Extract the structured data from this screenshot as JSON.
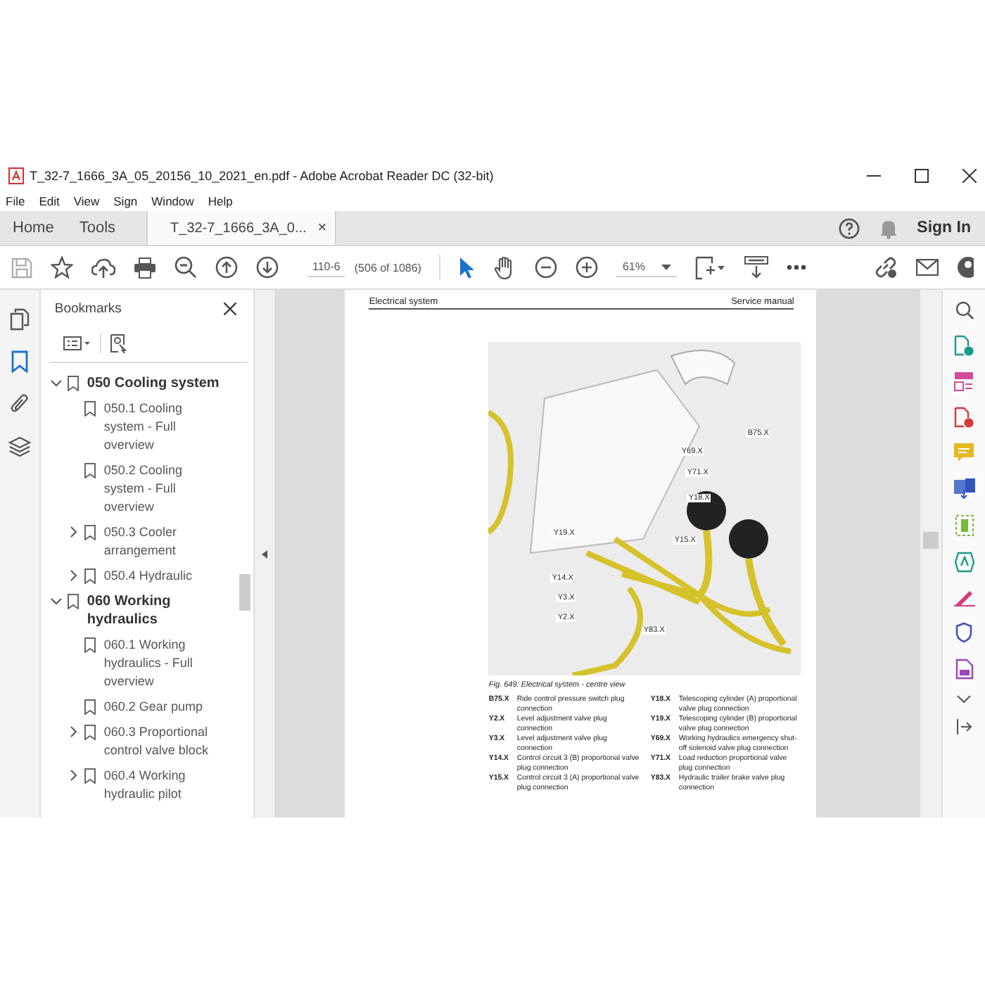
{
  "window": {
    "title": "T_32-7_1666_3A_05_20156_10_2021_en.pdf - Adobe Acrobat Reader DC (32-bit)"
  },
  "menu": [
    "File",
    "Edit",
    "View",
    "Sign",
    "Window",
    "Help"
  ],
  "tabs": [
    {
      "label": "Home",
      "selected": false
    },
    {
      "label": "Tools",
      "selected": false
    },
    {
      "label": "T_32-7_1666_3A_0...",
      "selected": true,
      "close": "×"
    }
  ],
  "sign_in": "Sign In",
  "toolbar": {
    "page": "110-6",
    "page_count": "(506 of 1086)",
    "zoom": "61%"
  },
  "rail": [
    {
      "kind": "pages",
      "selected": false
    },
    {
      "kind": "bookmarks",
      "selected": true
    },
    {
      "kind": "attachments",
      "selected": false
    },
    {
      "kind": "layers",
      "selected": false
    }
  ],
  "bookmarks": {
    "title": "Bookmarks",
    "items": [
      {
        "label": "050 Cooling system",
        "kind": "branch",
        "expanded": true,
        "children": [
          {
            "label": "050.1 Cooling system - Full overview",
            "kind": "leaf"
          },
          {
            "label": "050.2 Cooling system - Full overview",
            "kind": "leaf"
          },
          {
            "label": "050.3 Cooler arrangement",
            "kind": "branch",
            "expanded": false
          },
          {
            "label": "050.4 Hydraulic",
            "kind": "branch",
            "expanded": false
          }
        ]
      },
      {
        "label": "060 Working hydraulics",
        "kind": "branch",
        "expanded": true,
        "children": [
          {
            "label": "060.1 Working hydraulics - Full overview",
            "kind": "leaf"
          },
          {
            "label": "060.2 Gear pump",
            "kind": "leaf"
          },
          {
            "label": "060.3 Proportional control valve block",
            "kind": "branch",
            "expanded": false
          },
          {
            "label": "060.4 Working hydraulic pilot",
            "kind": "branch",
            "expanded": false
          }
        ]
      }
    ]
  },
  "page": {
    "header_left": "Electrical system",
    "header_right": "Service manual",
    "callouts": [
      "B75.X",
      "Y69.X",
      "Y71.X",
      "Y18.X",
      "Y19.X",
      "Y15.X",
      "Y14.X",
      "Y3.X",
      "Y2.X",
      "Y83.X"
    ],
    "caption": "Fig. 649: Electrical system - centre view",
    "legend": [
      {
        "code": "B75.X",
        "text": "Ride control pressure switch plug connection"
      },
      {
        "code": "Y2.X",
        "text": "Level adjustment valve plug connection"
      },
      {
        "code": "Y3.X",
        "text": "Level adjustment valve plug connection"
      },
      {
        "code": "Y14.X",
        "text": "Control circuit 3 (B) proportional valve plug connection"
      },
      {
        "code": "Y15.X",
        "text": "Control circuit 3 (A) proportional valve plug connection"
      },
      {
        "code": "Y18.X",
        "text": "Telescoping cylinder (A) proportional valve plug connection"
      },
      {
        "code": "Y19.X",
        "text": "Telescoping cylinder (B) proportional valve plug connection"
      },
      {
        "code": "Y69.X",
        "text": "Working hydraulics emergency shut-off solenoid valve plug connection"
      },
      {
        "code": "Y71.X",
        "text": "Load reduction proportional valve plug connection"
      },
      {
        "code": "Y83.X",
        "text": "Hydraulic trailer brake valve plug connection"
      }
    ]
  }
}
